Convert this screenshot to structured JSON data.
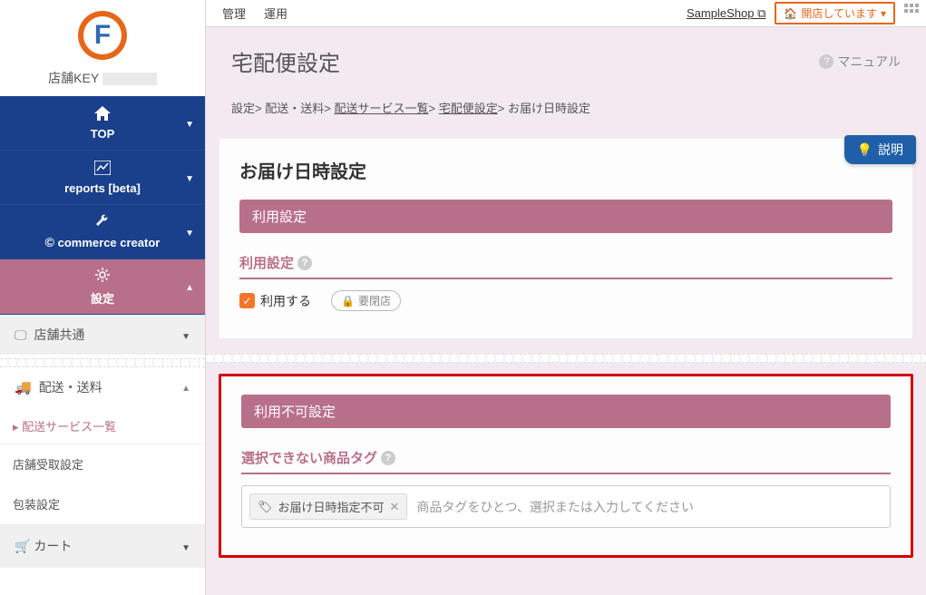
{
  "shop_key_label": "店舗KEY",
  "nav": {
    "top": "TOP",
    "reports": "reports [beta]",
    "commerce": "commerce creator",
    "settings": "設定"
  },
  "subnav": {
    "shop_common": "店舗共通",
    "shipping": "配送・送料",
    "shipping_list": "配送サービス一覧",
    "pickup": "店舗受取設定",
    "packaging": "包装設定",
    "cart": "カート"
  },
  "topbar": {
    "tab_admin": "管理",
    "tab_ops": "運用",
    "sample_shop": "SampleShop",
    "status": "開店しています"
  },
  "page": {
    "title": "宅配便設定",
    "manual": "マニュアル"
  },
  "breadcrumb": {
    "b1": "設定",
    "b2": "配送・送料",
    "b3": "配送サービス一覧",
    "b4": "宅配便設定",
    "b5": "お届け日時設定",
    "sep": "> "
  },
  "card1": {
    "title": "お届け日時設定",
    "section": "利用設定",
    "field": "利用設定",
    "checkbox": "利用する",
    "badge": "要閉店",
    "explain": "説明"
  },
  "card2": {
    "section": "利用不可設定",
    "field": "選択できない商品タグ",
    "tag": "お届け日時指定不可",
    "placeholder": "商品タグをひとつ、選択または入力してください"
  }
}
